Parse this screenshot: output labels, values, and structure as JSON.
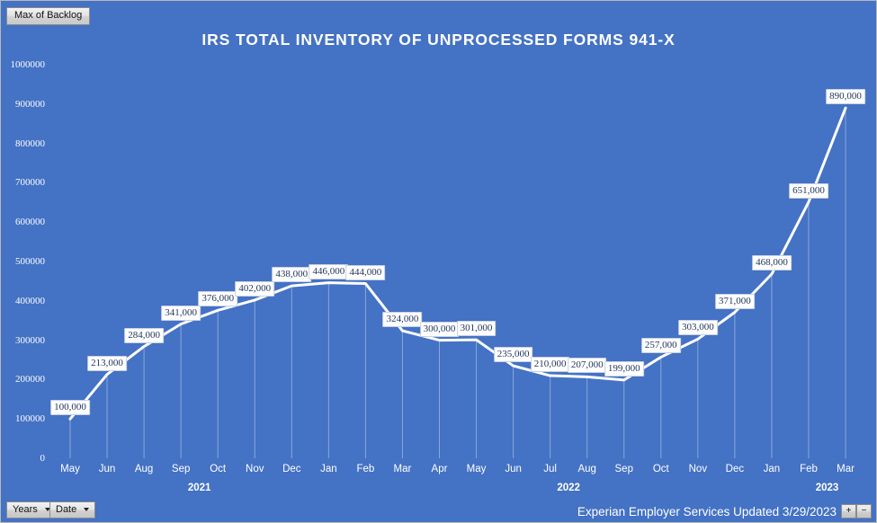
{
  "window": {
    "background_color": "#4472C4",
    "border_color": "#b8b8b8"
  },
  "legend": {
    "field_button_label": "Max of Backlog"
  },
  "header": {
    "title": "IRS TOTAL INVENTORY OF UNPROCESSED FORMS 941-X"
  },
  "footer": {
    "years_button_label": "Years",
    "date_button_label": "Date",
    "note": "Experian Employer Services Updated 3/29/2023",
    "zoom_in_label": "+",
    "zoom_out_label": "−"
  },
  "chart_data": {
    "type": "line",
    "title": "IRS TOTAL INVENTORY OF UNPROCESSED FORMS 941-X",
    "xlabel": "",
    "ylabel": "",
    "series_name": "Max of Backlog",
    "line_color": "#ffffff",
    "grid": false,
    "legend_position": "top-left",
    "ylim": [
      0,
      1000000
    ],
    "ytick_step": 100000,
    "ytick_labels": [
      "1000000",
      "900000",
      "800000",
      "700000",
      "600000",
      "500000",
      "400000",
      "300000",
      "200000",
      "100000",
      "0"
    ],
    "ytick_values": [
      1000000,
      900000,
      800000,
      700000,
      600000,
      500000,
      400000,
      300000,
      200000,
      100000,
      0
    ],
    "categories": [
      "May",
      "Jun",
      "Aug",
      "Sep",
      "Oct",
      "Nov",
      "Dec",
      "Jan",
      "Feb",
      "Mar",
      "Apr",
      "May",
      "Jun",
      "Jul",
      "Aug",
      "Sep",
      "Oct",
      "Nov",
      "Dec",
      "Jan",
      "Feb",
      "Mar"
    ],
    "values": [
      100000,
      213000,
      284000,
      341000,
      376000,
      402000,
      438000,
      446000,
      444000,
      324000,
      300000,
      301000,
      235000,
      210000,
      207000,
      199000,
      257000,
      303000,
      371000,
      468000,
      651000,
      890000
    ],
    "data_labels": [
      "100,000",
      "213,000",
      "284,000",
      "341,000",
      "376,000",
      "402,000",
      "438,000",
      "446,000",
      "444,000",
      "324,000",
      "300,000",
      "301,000",
      "235,000",
      "210,000",
      "207,000",
      "199,000",
      "257,000",
      "303,000",
      "371,000",
      "468,000",
      "651,000",
      "890,000"
    ],
    "year_groups": [
      {
        "label": "2021",
        "center_index": 3
      },
      {
        "label": "2022",
        "center_index": 13
      },
      {
        "label": "2023",
        "center_index": 20
      }
    ]
  }
}
